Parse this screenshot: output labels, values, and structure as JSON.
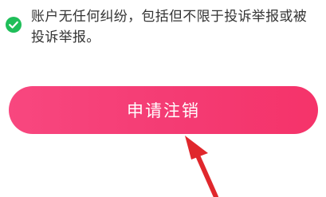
{
  "condition": {
    "icon": "check-circle-icon",
    "icon_color": "#1fbe59",
    "text": "账户无任何纠纷，包括但不限于投诉举报或被投诉举报。"
  },
  "apply_button": {
    "label": "申请注销",
    "color": "#f43b73"
  },
  "annotation": {
    "icon": "red-arrow-icon",
    "color": "#e0272c"
  }
}
